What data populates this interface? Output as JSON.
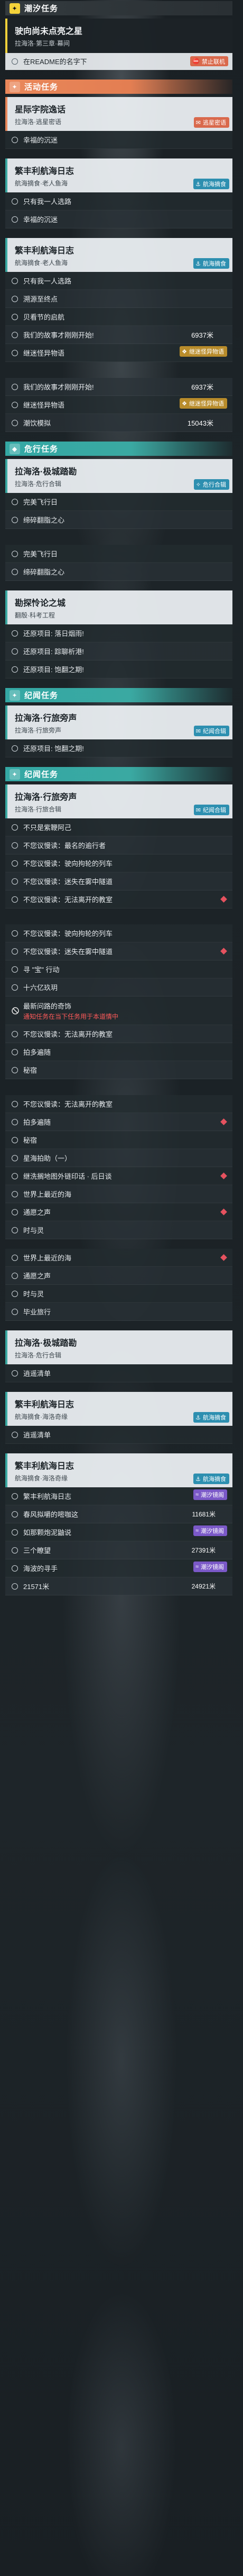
{
  "sections": {
    "s1": {
      "category": "潮汐任务",
      "badge": "✦"
    },
    "s2": {
      "quest_title": "驶向尚未点亮之星",
      "quest_sub": "拉海洛·第三章·幕间",
      "sub_item": "在README的名字下",
      "sub_tag": "禁止联机"
    },
    "s3": {
      "category": "活动任务",
      "badge": "✦"
    },
    "s4": {
      "quest_title": "星际字院逸话",
      "quest_sub": "拉海洛·逃星密语",
      "tag": "逃星密语",
      "items": [
        "幸福的沉迷"
      ]
    },
    "s5": {
      "quest_title": "繁丰利航海日志",
      "quest_sub": "航海摘食·老人鱼海",
      "tag": "航海摘食",
      "items": [
        "只有我一人选路",
        "幸福的沉迷"
      ]
    },
    "s6": {
      "quest_title": "繁丰利航海日志",
      "quest_sub": "航海摘食·老人鱼海",
      "tag": "航海摘食",
      "items": [
        "只有我一人选路",
        "溯源至终点",
        "贝看节的启航",
        "我们的故事才刚刚开始!",
        "继迷怪异物语"
      ],
      "value": "6937米",
      "value_tag": "继迷怪异物语"
    },
    "s7": {
      "items": [
        "我们的故事才刚刚开始!",
        "继迷怪异物语",
        "潮饮模拟"
      ],
      "value1": "6937米",
      "value2": "15043米",
      "value_tag": "继迷怪异物语"
    },
    "s8": {
      "category": "危行任务",
      "badge": "◆"
    },
    "s9": {
      "quest_title": "拉海洛·极城踏勘",
      "quest_sub": "拉海洛·危行合辑",
      "tag": "危行合辑",
      "items": [
        "完美飞行日",
        "缔碎翻脂之心"
      ]
    },
    "s10": {
      "items": [
        "完美飞行日",
        "缔碎翻脂之心"
      ]
    },
    "s11": {
      "quest_title": "勘探怜论之城",
      "quest_sub": "翻殷·科考工程",
      "items": [
        "还原项目: 落日烟雨!",
        "还原项目: 踪聊析港!",
        "还原项目: 饱翻之期!"
      ]
    },
    "s12": {
      "category": "纪闻任务",
      "badge": "✦"
    },
    "s13": {
      "quest_title": "拉海洛·行旅旁声",
      "quest_sub": "拉海洛·行旅旁声",
      "tag": "纪闻合辑",
      "items": [
        "还原项目: 饱翻之期!"
      ]
    },
    "s14": {
      "category": "纪闻任务",
      "badge": "✦"
    },
    "s15": {
      "quest_title": "拉海洛·行旅旁声",
      "quest_sub": "拉海洛·行旅合辑",
      "tag": "纪闻合辑",
      "items": [
        "不只是紫鞭阿己",
        "不您议慢读：最名的逾行者",
        "不您议慢读：驶向拘轮的列车",
        "不您议慢读：迷失在雾中隧道",
        "不您议慢读：无法离开的教室"
      ]
    },
    "s16": {
      "items": [
        "不您议慢读：驶向拘轮的列车",
        "不您议慢读：迷失在雾中隧道",
        "寻 \"宝\" 行动",
        "十六亿玖玥",
        "最新问路的奇饰",
        "不您议慢读：无法离开的教室",
        "拍多遍随",
        "秘宿"
      ],
      "red_warn": "通知任务在当下任务用于本道情中"
    },
    "s17": {
      "items": [
        "不您议慢读：无法离开的教室",
        "拍多遍随",
        "秘宿",
        "星海拍助（一）",
        "继洗搁地图外链印话 · 后日谈",
        "世界上最近的海",
        "通愿之声",
        "时与灵",
        "世界上最近的海",
        "通愿之声",
        "时与灵",
        "毕业旅行"
      ]
    },
    "s18": {
      "quest_title": "拉海洛·极城踏勘",
      "quest_sub": "拉海洛·危行合辑",
      "items": [
        "逍遥清单"
      ]
    },
    "s19": {
      "quest_title": "繁丰利航海日志",
      "quest_sub": "航海摘食·海洛奇缘",
      "tag": "航海摘食",
      "items": [
        "逍遥清单"
      ]
    },
    "s20": {
      "quest_title": "繁丰利航海日志",
      "quest_sub": "航海摘食·海洛奇缘",
      "tag": "航海摘食",
      "items": [
        "繁丰利航海日志",
        "春风拟嚼的嘧咖这",
        "如那颗炮泥鼬说",
        "三个瞭望",
        "海波的寻手"
      ],
      "value1": "11681米",
      "value2": "27391米",
      "value3": "21571米",
      "value4": "24921米",
      "tag_purple": "潮汐镜阁"
    }
  }
}
